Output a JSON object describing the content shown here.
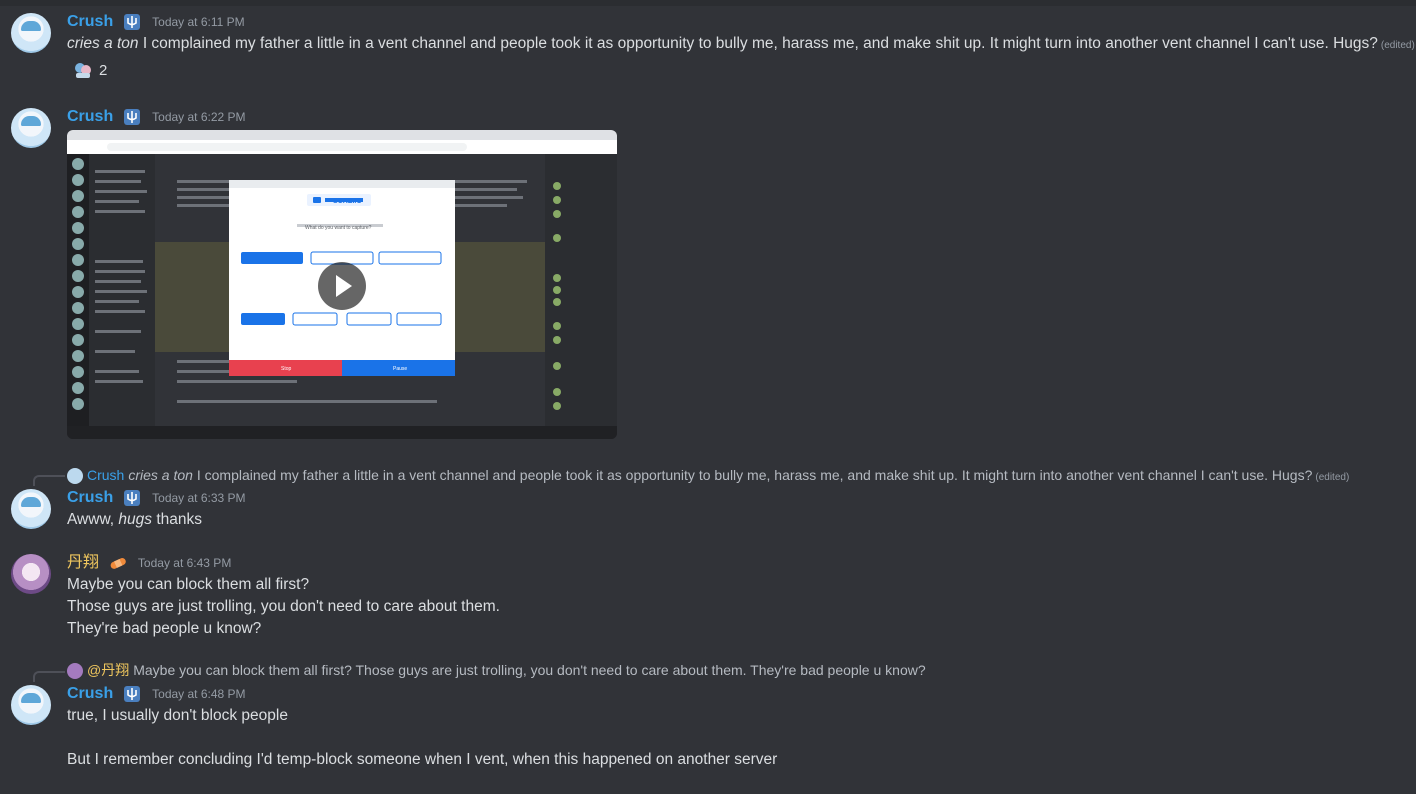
{
  "colors": {
    "background": "#313338",
    "username_blue": "#3aa0e8",
    "username_gold": "#f0c75e",
    "timestamp": "#949ba4",
    "text": "#dbdee1"
  },
  "messages": [
    {
      "author": "Crush",
      "time": "Today at 6:11 PM",
      "italic_lead": "cries a ton",
      "text": " I complained my father a little in a vent channel and people took it as opportunity to bully me, harass me, and make shit up. It might turn into another vent channel I can't use. Hugs?",
      "edited": "(edited)",
      "reaction_count": "2"
    },
    {
      "author": "Crush",
      "time": "Today at 6:22 PM",
      "attachment": {
        "type": "video-screenshot",
        "inner_overlay_title": "SCRE.IO",
        "inner_prompt": "What do you want to capture?",
        "stop_label": "Stop",
        "pause_label": "Pause"
      }
    },
    {
      "reply_to": {
        "author": "Crush",
        "italic_lead": "cries a ton",
        "text": " I complained my father a little in a vent channel and people took it as opportunity to bully me, harass me, and make shit up. It might turn into another vent channel I can't use. Hugs?",
        "edited": "(edited)"
      },
      "author": "Crush",
      "time": "Today at 6:33 PM",
      "text_before": "Awww, ",
      "italic": "hugs",
      "text_after": " thanks"
    },
    {
      "author": "丹翔",
      "time": "Today at 6:43 PM",
      "lines": [
        "Maybe you can block them all first?",
        "Those guys are just trolling, you don't need to care about them.",
        "They're bad people u know?"
      ]
    },
    {
      "reply_to": {
        "author": "@丹翔",
        "text": "Maybe you can block them all first? Those guys are just trolling, you don't need to care about them. They're bad people u know?"
      },
      "author": "Crush",
      "time": "Today at 6:48 PM",
      "lines": [
        "true, I usually don't block people",
        "But I remember concluding I'd temp-block someone when I vent, when this happened on another server"
      ]
    }
  ]
}
